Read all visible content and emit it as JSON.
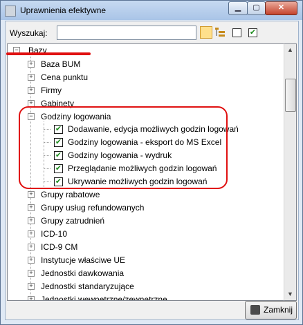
{
  "window": {
    "title": "Uprawnienia efektywne"
  },
  "toolbar": {
    "search_label": "Wyszukaj:",
    "search_value": ""
  },
  "tree": {
    "root": "Bazy",
    "items": [
      "Baza BUM",
      "Cena punktu",
      "Firmy",
      "Gabinety",
      "Godziny logowania",
      "Grupy rabatowe",
      "Grupy usług refundowanych",
      "Grupy zatrudnień",
      "ICD-10",
      "ICD-9 CM",
      "Instytucje właściwe UE",
      "Jednostki dawkowania",
      "Jednostki standaryzujące",
      "Jednostki wewnętrzne/zewnętrzne"
    ],
    "expanded_children": [
      "Dodawanie, edycja  możliwych godzin logowań",
      "Godziny logowania - eksport do MS Excel",
      "Godziny logowania - wydruk",
      "Przeglądanie możliwych godzin logowań",
      "Ukrywanie możliwych godzin logowań"
    ]
  },
  "footer": {
    "close_label": "Zamknij"
  },
  "colors": {
    "annotation": "#e01010",
    "check": "#1a8a1a"
  }
}
